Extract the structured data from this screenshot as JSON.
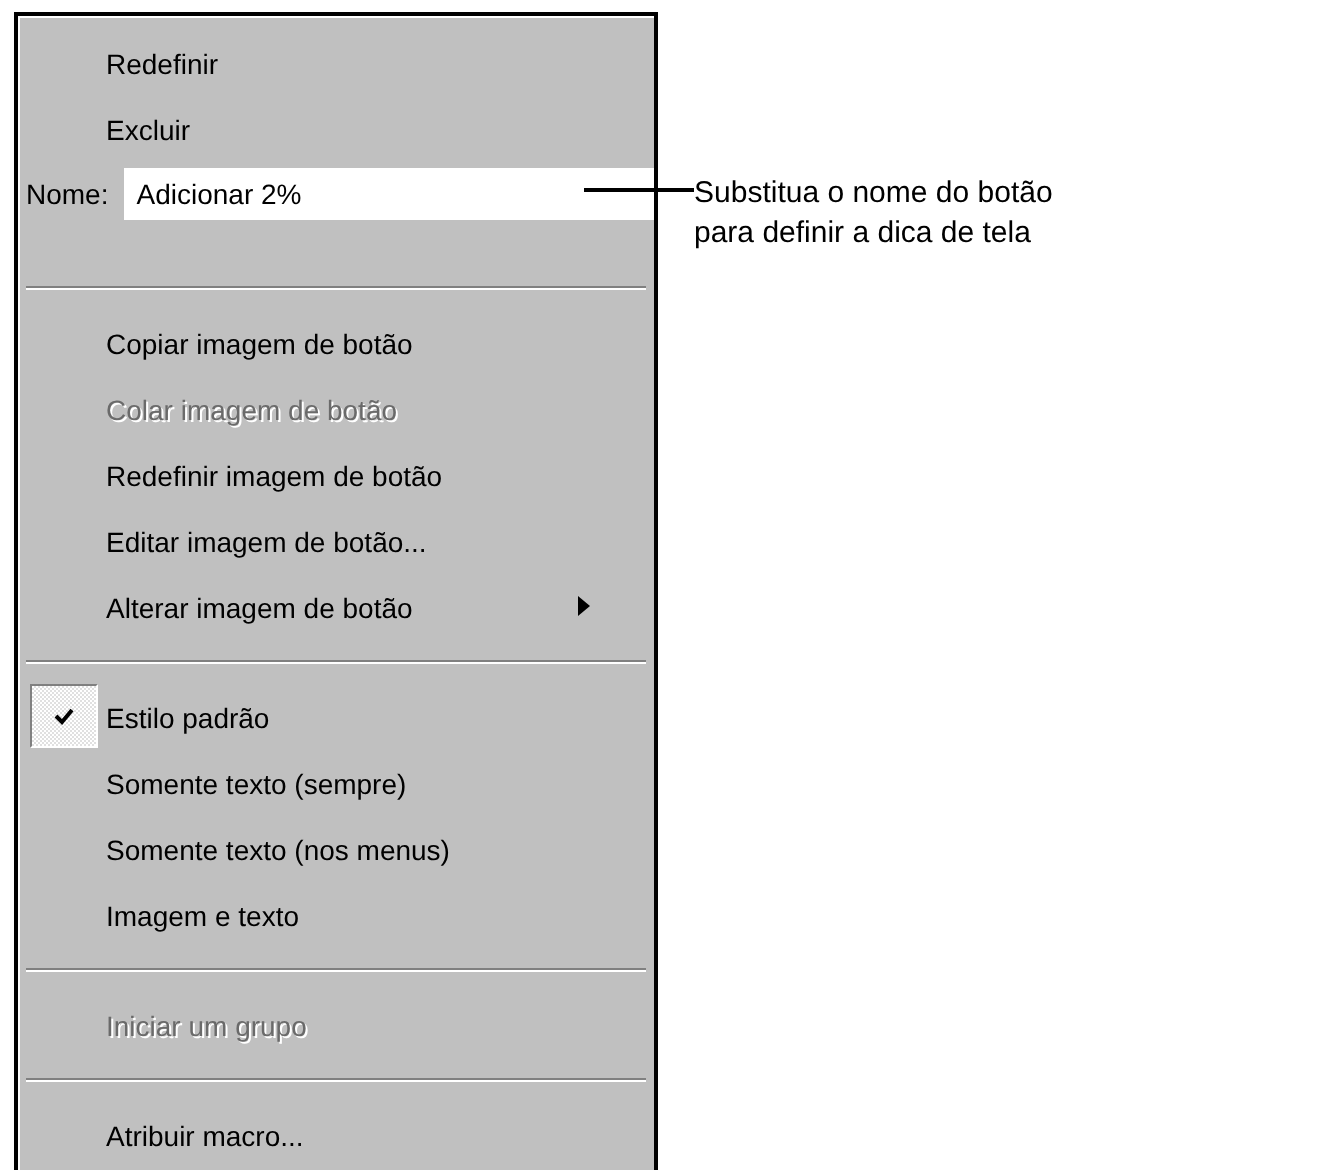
{
  "menu": {
    "items": [
      {
        "kind": "item",
        "label": "Redefinir",
        "disabled": false,
        "checked": false,
        "submenu": false
      },
      {
        "kind": "item",
        "label": "Excluir",
        "disabled": false,
        "checked": false,
        "submenu": false
      },
      {
        "kind": "field",
        "label": "Nome:",
        "value": "Adicionar 2%"
      },
      {
        "kind": "separator"
      },
      {
        "kind": "item",
        "label": "Copiar imagem de botão",
        "disabled": false,
        "checked": false,
        "submenu": false
      },
      {
        "kind": "item",
        "label": "Colar imagem de botão",
        "disabled": true,
        "checked": false,
        "submenu": false
      },
      {
        "kind": "item",
        "label": "Redefinir imagem de botão",
        "disabled": false,
        "checked": false,
        "submenu": false
      },
      {
        "kind": "item",
        "label": "Editar imagem de botão...",
        "disabled": false,
        "checked": false,
        "submenu": false
      },
      {
        "kind": "item",
        "label": "Alterar imagem de botão",
        "disabled": false,
        "checked": false,
        "submenu": true
      },
      {
        "kind": "separator"
      },
      {
        "kind": "item",
        "label": "Estilo padrão",
        "disabled": false,
        "checked": true,
        "submenu": false
      },
      {
        "kind": "item",
        "label": "Somente texto (sempre)",
        "disabled": false,
        "checked": false,
        "submenu": false
      },
      {
        "kind": "item",
        "label": "Somente texto (nos menus)",
        "disabled": false,
        "checked": false,
        "submenu": false
      },
      {
        "kind": "item",
        "label": "Imagem e texto",
        "disabled": false,
        "checked": false,
        "submenu": false
      },
      {
        "kind": "separator"
      },
      {
        "kind": "item",
        "label": "Iniciar um grupo",
        "disabled": true,
        "checked": false,
        "submenu": false
      },
      {
        "kind": "separator"
      },
      {
        "kind": "item",
        "label": "Atribuir macro...",
        "disabled": false,
        "checked": false,
        "submenu": false
      }
    ]
  },
  "callout": {
    "lines": [
      "Substitua o nome do botão",
      "para definir a dica de tela"
    ]
  }
}
